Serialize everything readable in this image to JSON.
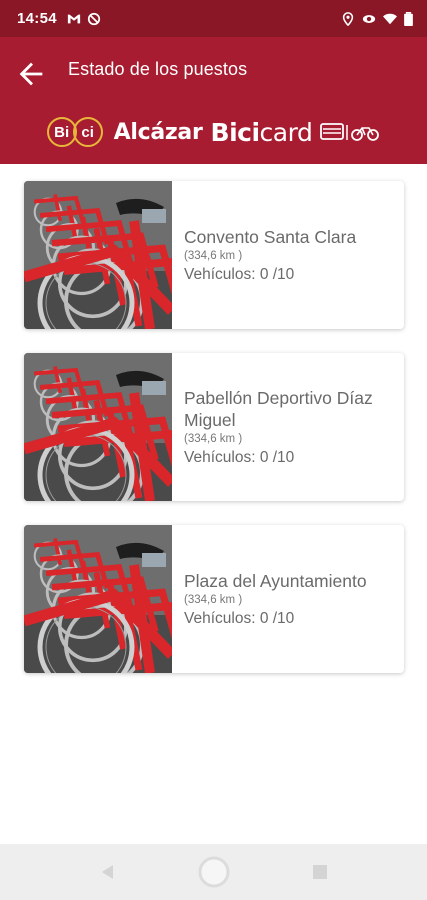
{
  "status_bar": {
    "time": "14:54",
    "left_icons": [
      "gmail-icon",
      "no-sim-icon"
    ],
    "right_icons": [
      "location-icon",
      "eye-icon",
      "wifi-icon",
      "battery-icon"
    ]
  },
  "app_bar": {
    "title": "Estado de los puestos",
    "back_icon": "arrow-back-icon",
    "brand": {
      "bici_letters_1": "Bi",
      "bici_letters_2": "ci",
      "alcazar": "Alcázar",
      "bicicard_bold": "Bici",
      "bicicard_light": "card"
    }
  },
  "colors": {
    "status_bar": "#8a1726",
    "app_bar": "#a81c31",
    "accent_gold": "#e7b73a",
    "bike_red": "#d8262a"
  },
  "stations": [
    {
      "name": "Convento Santa Clara",
      "distance": "(334,6 km )",
      "vehicles": "Vehículos: 0 /10"
    },
    {
      "name": "Pabellón Deportivo Díaz Miguel",
      "distance": "(334,6 km )",
      "vehicles": "Vehículos: 0 /10"
    },
    {
      "name": "Plaza del Ayuntamiento",
      "distance": "(334,6 km )",
      "vehicles": "Vehículos: 0 /10"
    }
  ],
  "nav_bar": {
    "buttons": [
      "back-triangle-icon",
      "home-circle-icon",
      "recents-square-icon"
    ]
  }
}
